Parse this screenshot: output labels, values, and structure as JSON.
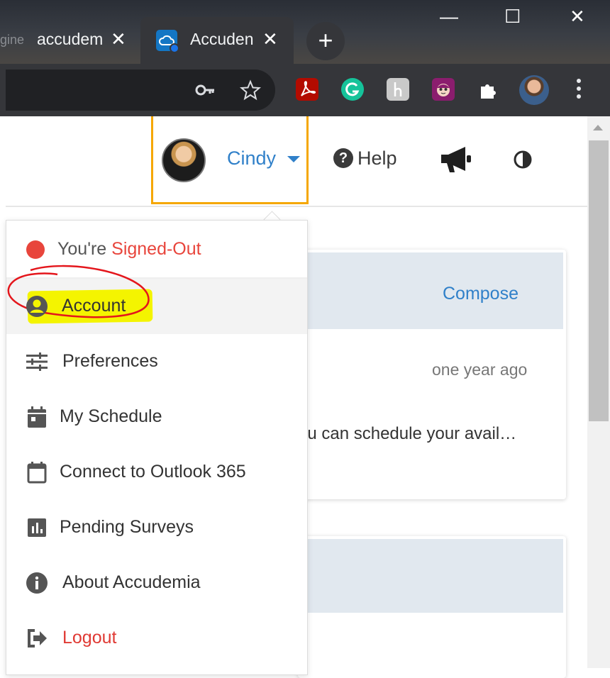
{
  "browser": {
    "tabs": [
      {
        "title": "accudem",
        "faded_prefix": "gine",
        "active": false
      },
      {
        "title": "Accuden",
        "active": true
      }
    ],
    "new_tab": "+",
    "window_controls": {
      "minimize": "—",
      "maximize": "☐",
      "close": "✕"
    },
    "tab_close": "✕",
    "toolbar_icons": [
      "key-icon",
      "star-icon",
      "adobe-acrobat-icon",
      "grammarly-icon",
      "honey-icon",
      "extension-face-icon",
      "puzzle-icon",
      "profile-avatar",
      "kebab-menu-icon"
    ]
  },
  "header": {
    "user_name": "Cindy",
    "help_label": "Help",
    "accent_color": "#f5a700",
    "link_color": "#3080c9"
  },
  "dropdown": {
    "status_prefix": "You're ",
    "status_value": "Signed-Out",
    "status_color": "#e8453c",
    "items": [
      {
        "label": "Account",
        "icon": "account-circle-icon",
        "active": true
      },
      {
        "label": "Preferences",
        "icon": "sliders-icon"
      },
      {
        "label": "My Schedule",
        "icon": "calendar-filled-icon"
      },
      {
        "label": "Connect to Outlook 365",
        "icon": "calendar-outline-icon"
      },
      {
        "label": "Pending Surveys",
        "icon": "bar-chart-icon"
      },
      {
        "label": "About Accudemia",
        "icon": "info-icon"
      },
      {
        "label": "Logout",
        "icon": "logout-icon"
      }
    ]
  },
  "content": {
    "compose_label": "Compose",
    "timestamp": "one year ago",
    "snippet": "ou can schedule your avail…"
  }
}
